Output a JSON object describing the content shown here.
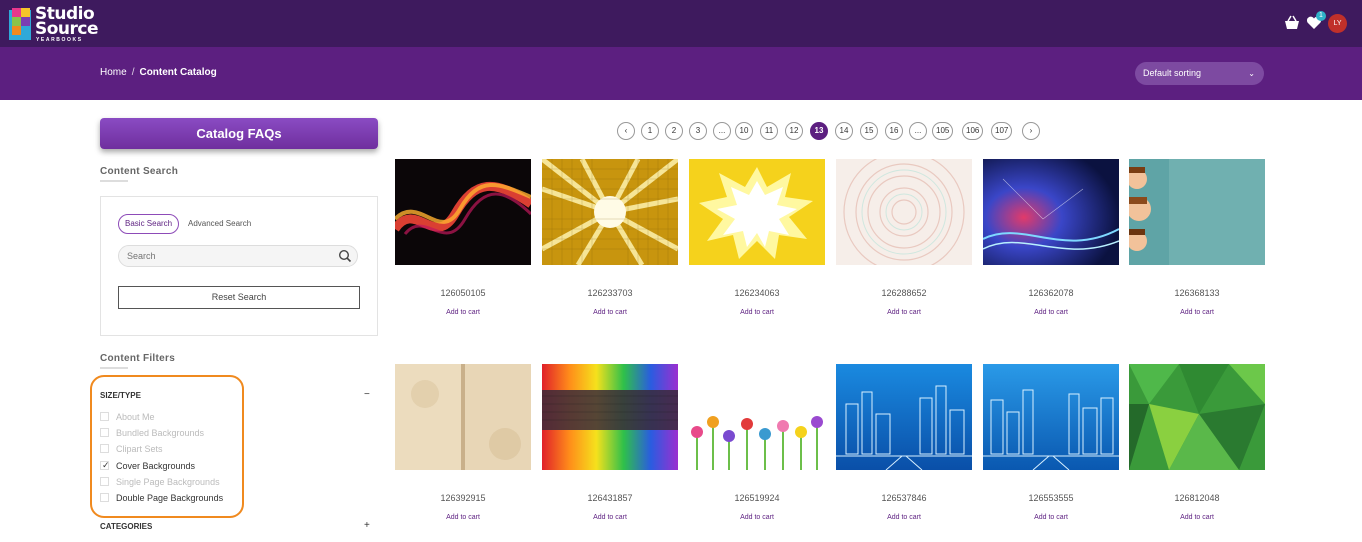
{
  "brand": {
    "line1": "Studio",
    "line2": "Source",
    "line3": "YEARBOOKS"
  },
  "header": {
    "wishlist_count": "1",
    "avatar_initials": "LY",
    "icons": [
      "basket-icon",
      "heart-icon"
    ]
  },
  "breadcrumb": {
    "home": "Home",
    "separator": "/",
    "current": "Content Catalog"
  },
  "sorting": {
    "selected": "Default sorting"
  },
  "sidebar": {
    "faq_label": "Catalog FAQs",
    "content_search_title": "Content Search",
    "tabs": {
      "basic": "Basic Search",
      "advanced": "Advanced Search"
    },
    "search_placeholder": "Search",
    "reset_label": "Reset Search",
    "filters_title": "Content Filters",
    "size_type": {
      "heading": "SIZE/TYPE",
      "toggle": "−",
      "items": [
        {
          "label": "About Me",
          "checked": false,
          "enabled": false
        },
        {
          "label": "Bundled Backgrounds",
          "checked": false,
          "enabled": false
        },
        {
          "label": "Clipart Sets",
          "checked": false,
          "enabled": false
        },
        {
          "label": "Cover Backgrounds",
          "checked": true,
          "enabled": true
        },
        {
          "label": "Single Page Backgrounds",
          "checked": false,
          "enabled": false
        },
        {
          "label": "Double Page Backgrounds",
          "checked": false,
          "enabled": true
        }
      ]
    },
    "categories": {
      "heading": "CATEGORIES",
      "toggle": "+"
    }
  },
  "pagination": {
    "prev": "‹",
    "next": "›",
    "pages": [
      "1",
      "2",
      "3",
      "...",
      "10",
      "11",
      "12",
      "13",
      "14",
      "15",
      "16",
      "...",
      "105",
      "106",
      "107"
    ],
    "current": "13"
  },
  "products": [
    {
      "sku": "126050105",
      "add_label": "Add to cart",
      "image": "red-gold-light-wave"
    },
    {
      "sku": "126233703",
      "add_label": "Add to cart",
      "image": "yellow-sunburst-grid"
    },
    {
      "sku": "126234063",
      "add_label": "Add to cart",
      "image": "comic-burst"
    },
    {
      "sku": "126288652",
      "add_label": "Add to cart",
      "image": "pastel-mandala"
    },
    {
      "sku": "126362078",
      "add_label": "Add to cart",
      "image": "blue-abstract-lights"
    },
    {
      "sku": "126368133",
      "add_label": "Add to cart",
      "image": "teal-cartoon-kids"
    },
    {
      "sku": "126392915",
      "add_label": "Add to cart",
      "image": "old-open-book"
    },
    {
      "sku": "126431857",
      "add_label": "Add to cart",
      "image": "rainbow-spectrum"
    },
    {
      "sku": "126519924",
      "add_label": "Add to cart",
      "image": "crayon-flowers"
    },
    {
      "sku": "126537846",
      "add_label": "Add to cart",
      "image": "blue-city-line"
    },
    {
      "sku": "126553555",
      "add_label": "Add to cart",
      "image": "blue-city-line-2"
    },
    {
      "sku": "126812048",
      "add_label": "Add to cart",
      "image": "green-polygons"
    }
  ],
  "colors": {
    "topbar": "#3e1a5e",
    "subbar": "#5c1f80",
    "accent": "#5c1f80",
    "highlight": "#f08a1f"
  }
}
